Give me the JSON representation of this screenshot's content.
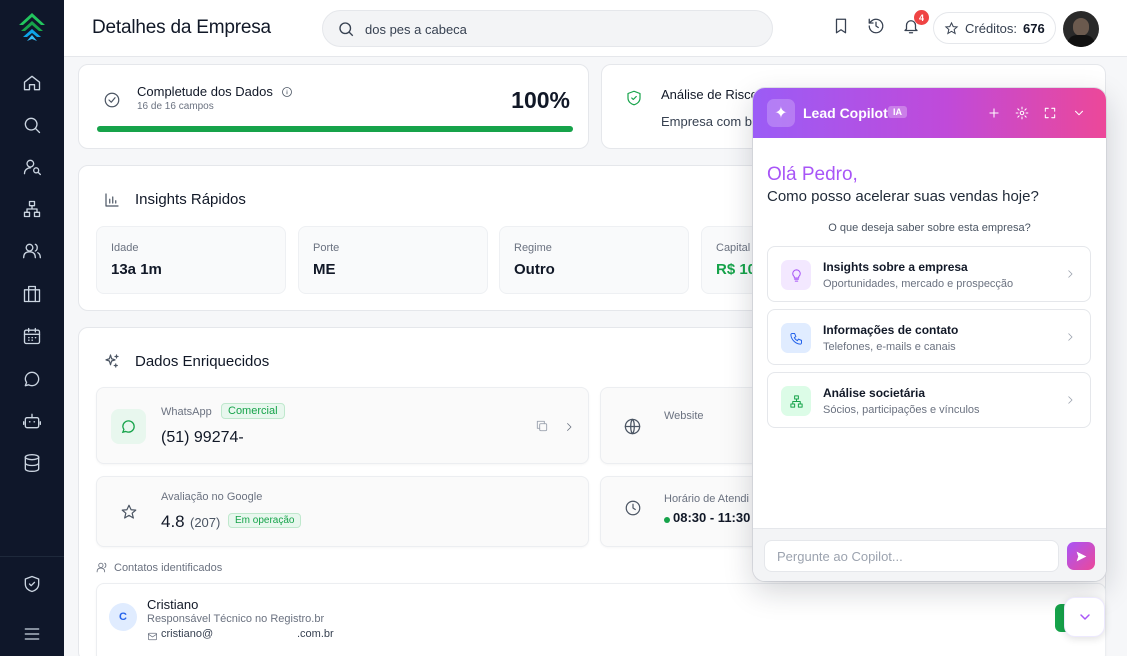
{
  "header": {
    "title": "Detalhes da Empresa",
    "search_value": "dos pes a cabeca",
    "notification_count": "4",
    "credits_label": "Créditos:",
    "credits_value": "676"
  },
  "completeness": {
    "title": "Completude dos Dados",
    "subtitle": "16 de 16 campos",
    "percent_label": "100%",
    "progress": 1.0,
    "bar_color": "#16a34a"
  },
  "risk": {
    "title": "Análise de Risco",
    "text": "Empresa com ba"
  },
  "insights": {
    "title": "Insights Rápidos",
    "stats": [
      {
        "label": "Idade",
        "value": "13a 1m"
      },
      {
        "label": "Porte",
        "value": "ME"
      },
      {
        "label": "Regime",
        "value": "Outro"
      },
      {
        "label": "Capital",
        "value": "R$ 10"
      }
    ]
  },
  "enriched": {
    "title": "Dados Enriquecidos",
    "whatsapp": {
      "label": "WhatsApp",
      "tag": "Comercial",
      "value": "(51) 99274-"
    },
    "website": {
      "label": "Website"
    },
    "google": {
      "label": "Avaliação no Google",
      "rating": "4.8",
      "count": "(207)",
      "tag": "Em operação"
    },
    "hours": {
      "label": "Horário de Atendi",
      "value": "08:30 - 11:30"
    }
  },
  "contacts": {
    "section_label": "Contatos identificados",
    "items": [
      {
        "initial": "C",
        "name": "Cristiano",
        "role": "Responsável Técnico no Registro.br",
        "email_prefix": "cristiano@",
        "email_suffix": ".com.br"
      }
    ]
  },
  "copilot": {
    "title": "Lead Copilot",
    "badge": "IA",
    "greeting": "Olá Pedro,",
    "subtitle": "Como posso acelerar suas vendas hoje?",
    "question": "O que deseja saber sobre esta empresa?",
    "options": [
      {
        "title": "Insights sobre a empresa",
        "subtitle": "Oportunidades, mercado e prospecção",
        "icon": "lightbulb-icon"
      },
      {
        "title": "Informações de contato",
        "subtitle": "Telefones, e-mails e canais",
        "icon": "phone-icon"
      },
      {
        "title": "Análise societária",
        "subtitle": "Sócios, participações e vínculos",
        "icon": "network-icon"
      }
    ],
    "input_placeholder": "Pergunte ao Copilot..."
  },
  "colors": {
    "sidebar": "#0f172a",
    "accent_purple": "#a855f7",
    "accent_pink": "#ec4899",
    "success_green": "#16a34a"
  }
}
